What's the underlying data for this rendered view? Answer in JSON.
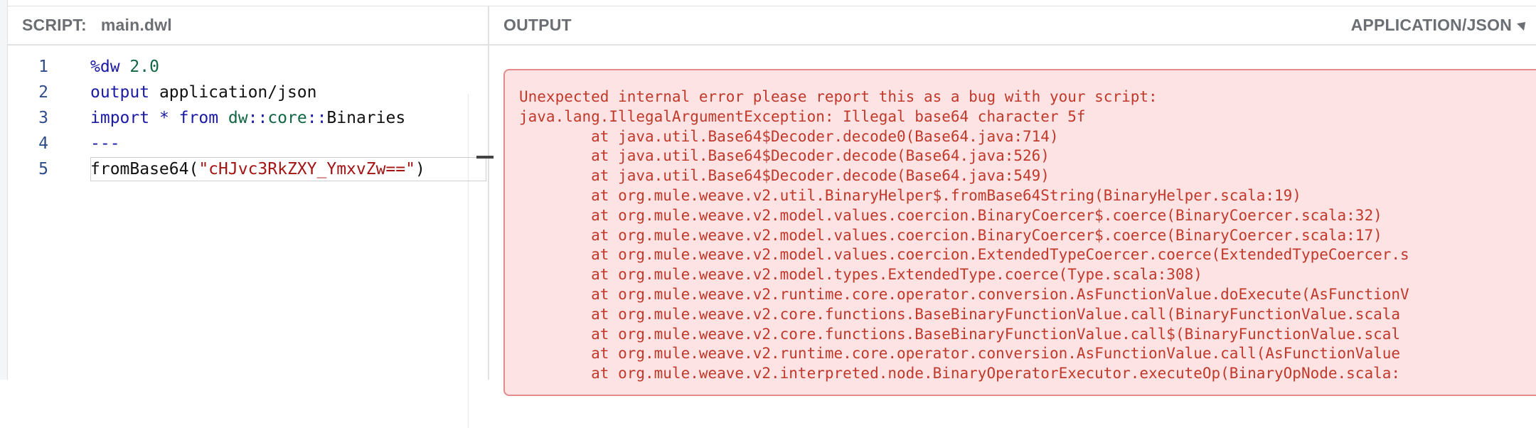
{
  "script": {
    "label": "SCRIPT:",
    "filename": "main.dwl",
    "lines": [
      {
        "num": "1",
        "parts": [
          {
            "t": "%dw ",
            "c": "kw"
          },
          {
            "t": "2.0",
            "c": "num"
          }
        ]
      },
      {
        "num": "2",
        "parts": [
          {
            "t": "output",
            "c": "kw"
          },
          {
            "t": " application/json",
            "c": "plain"
          }
        ]
      },
      {
        "num": "3",
        "parts": [
          {
            "t": "import",
            "c": "kw"
          },
          {
            "t": " ",
            "c": "plain"
          },
          {
            "t": "*",
            "c": "kw"
          },
          {
            "t": " ",
            "c": "plain"
          },
          {
            "t": "from",
            "c": "kw"
          },
          {
            "t": " ",
            "c": "plain"
          },
          {
            "t": "dw",
            "c": "num"
          },
          {
            "t": "::",
            "c": "kw"
          },
          {
            "t": "core",
            "c": "num"
          },
          {
            "t": "::",
            "c": "kw"
          },
          {
            "t": "Binaries",
            "c": "plain"
          }
        ]
      },
      {
        "num": "4",
        "parts": [
          {
            "t": "---",
            "c": "kw"
          }
        ]
      },
      {
        "num": "5",
        "parts": [
          {
            "t": "fromBase64(",
            "c": "plain"
          },
          {
            "t": "\"cHJvc3RkZXY_YmxvZw==\"",
            "c": "str"
          },
          {
            "t": ")",
            "c": "plain"
          }
        ]
      }
    ]
  },
  "output": {
    "label": "OUTPUT",
    "format": "APPLICATION/JSON",
    "error_lines": [
      "Unexpected internal error please report this as a bug with your script:",
      "java.lang.IllegalArgumentException: Illegal base64 character 5f",
      "        at java.util.Base64$Decoder.decode0(Base64.java:714)",
      "        at java.util.Base64$Decoder.decode(Base64.java:526)",
      "        at java.util.Base64$Decoder.decode(Base64.java:549)",
      "        at org.mule.weave.v2.util.BinaryHelper$.fromBase64String(BinaryHelper.scala:19)",
      "        at org.mule.weave.v2.model.values.coercion.BinaryCoercer$.coerce(BinaryCoercer.scala:32)",
      "        at org.mule.weave.v2.model.values.coercion.BinaryCoercer$.coerce(BinaryCoercer.scala:17)",
      "        at org.mule.weave.v2.model.values.coercion.ExtendedTypeCoercer.coerce(ExtendedTypeCoercer.s",
      "        at org.mule.weave.v2.model.types.ExtendedType.coerce(Type.scala:308)",
      "        at org.mule.weave.v2.runtime.core.operator.conversion.AsFunctionValue.doExecute(AsFunctionV",
      "        at org.mule.weave.v2.core.functions.BaseBinaryFunctionValue.call(BinaryFunctionValue.scala",
      "        at org.mule.weave.v2.core.functions.BaseBinaryFunctionValue.call$(BinaryFunctionValue.scal",
      "        at org.mule.weave.v2.runtime.core.operator.conversion.AsFunctionValue.call(AsFunctionValue",
      "        at org.mule.weave.v2.interpreted.node.BinaryOperatorExecutor.executeOp(BinaryOpNode.scala:"
    ]
  }
}
